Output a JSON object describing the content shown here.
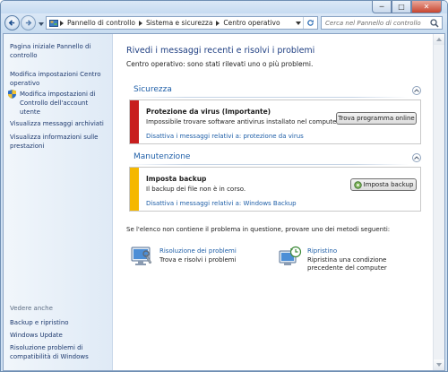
{
  "window": {
    "minimize": "─",
    "maximize": "□",
    "close": "✕"
  },
  "address_bar": {
    "crumbs": [
      "Pannello di controllo",
      "Sistema e sicurezza",
      "Centro operativo"
    ]
  },
  "search": {
    "placeholder": "Cerca nel Pannello di controllo"
  },
  "sidebar": {
    "links": [
      "Pagina iniziale Pannello di controllo",
      "Modifica impostazioni Centro operativo",
      "Modifica impostazioni di Controllo dell'account utente",
      "Visualizza messaggi archiviati",
      "Visualizza informazioni sulle prestazioni"
    ],
    "see_also_title": "Vedere anche",
    "see_also": [
      "Backup e ripristino",
      "Windows Update",
      "Risoluzione problemi di compatibilità di Windows"
    ]
  },
  "main": {
    "heading": "Rivedi i messaggi recenti e risolvi i problemi",
    "subheading": "Centro operativo: sono stati rilevati uno o più problemi.",
    "security": {
      "title": "Sicurezza",
      "alert": {
        "title": "Protezione da virus  (Importante)",
        "description": "Impossibile trovare software antivirus installato nel computer.",
        "link": "Disattiva i messaggi relativi a: protezione da virus",
        "button": "Trova programma online",
        "color": "#c81e1e"
      }
    },
    "maintenance": {
      "title": "Manutenzione",
      "alert": {
        "title": "Imposta backup",
        "description": "Il backup dei file non è in corso.",
        "link": "Disattiva i messaggi relativi a: Windows Backup",
        "button": "Imposta backup",
        "color": "#f5b800"
      }
    },
    "bottom_text": "Se l'elenco non contiene il problema in questione, provare uno dei metodi seguenti:",
    "tools": [
      {
        "title": "Risoluzione dei problemi",
        "description": "Trova e risolvi i problemi"
      },
      {
        "title": "Ripristino",
        "description": "Ripristina una condizione precedente del computer"
      }
    ]
  }
}
